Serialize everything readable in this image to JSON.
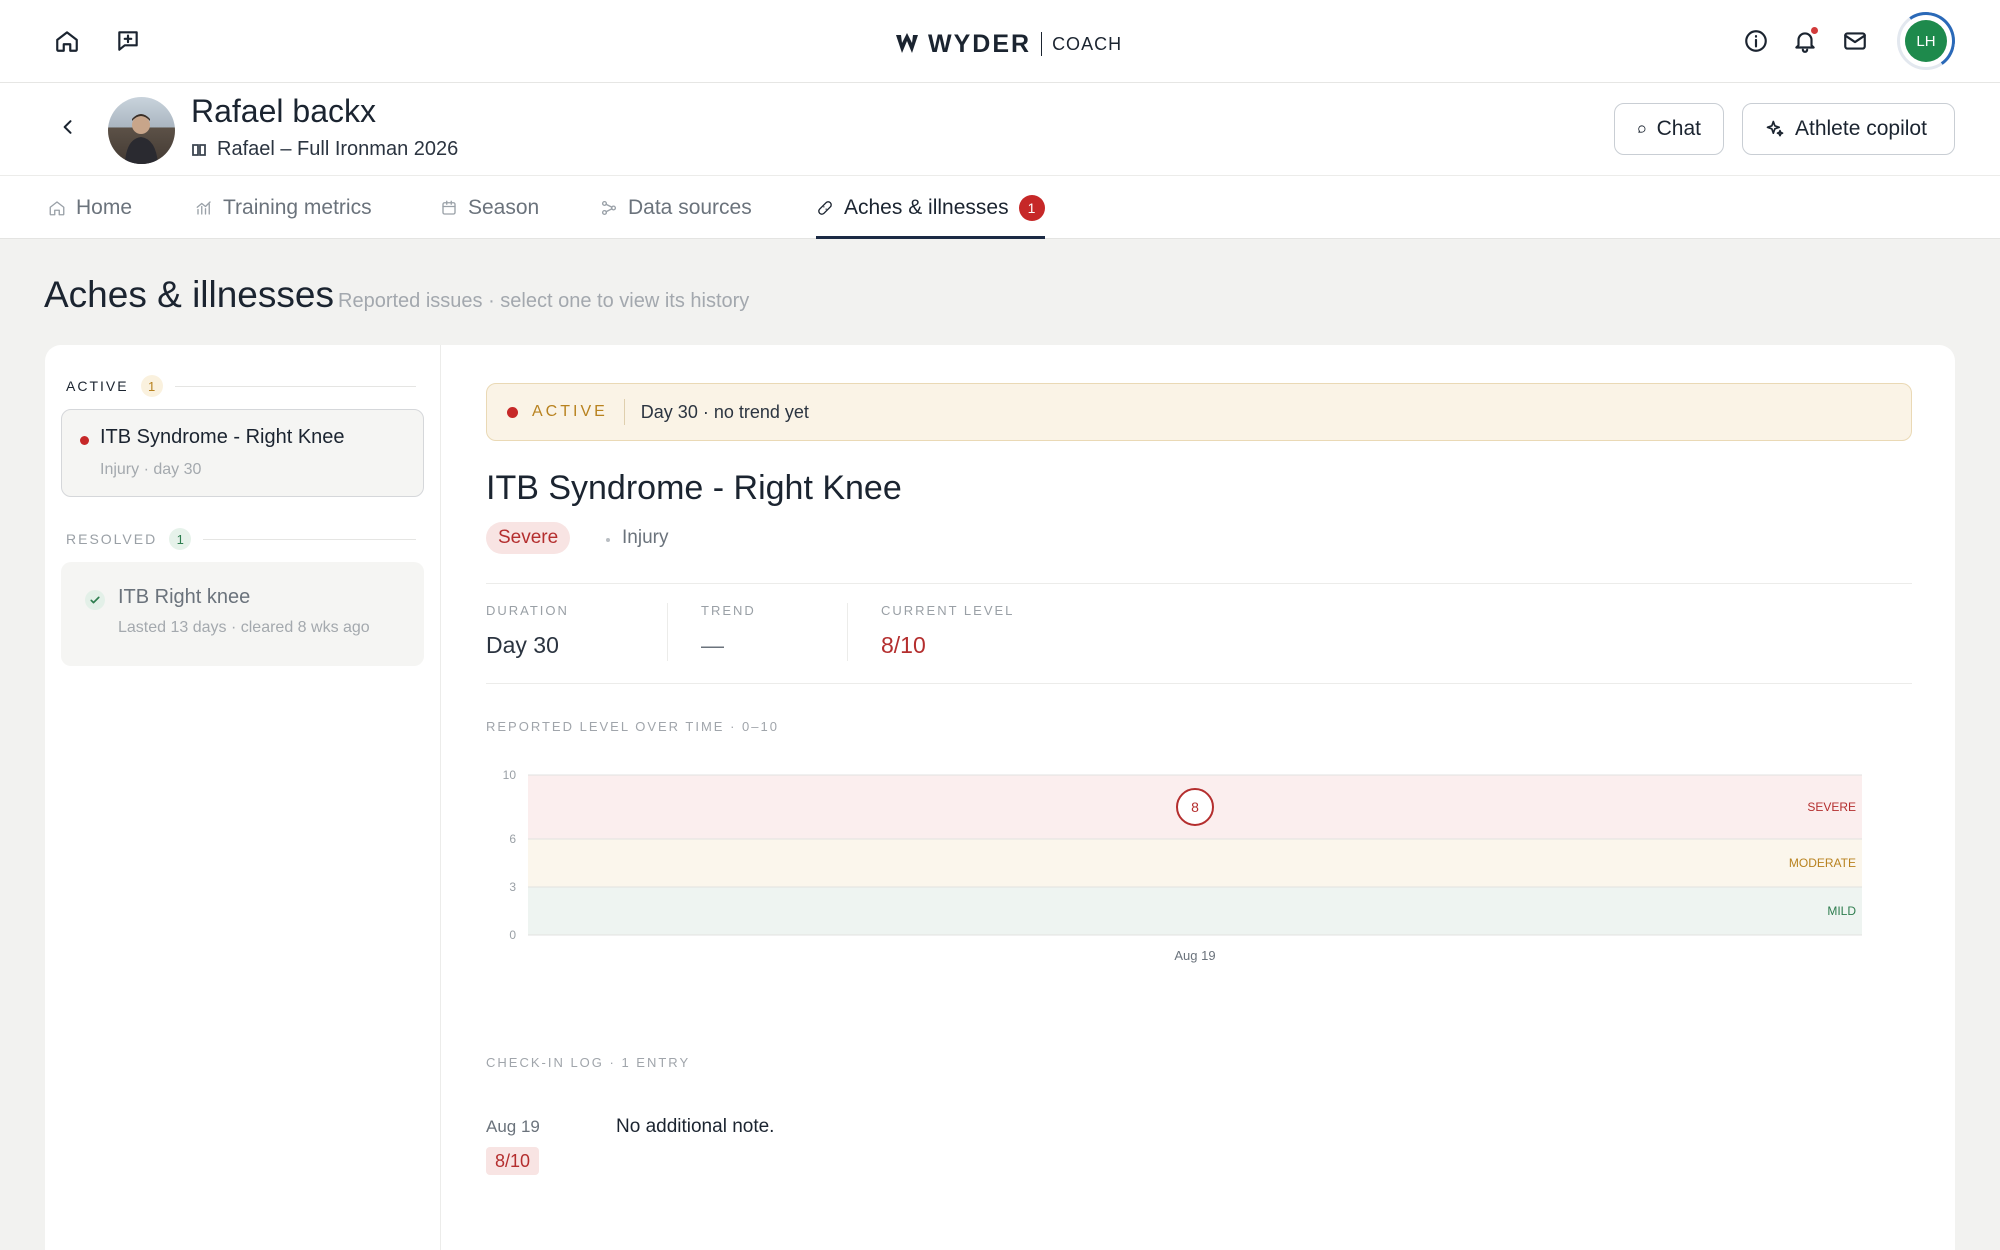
{
  "brand": {
    "name": "WYDER",
    "product": "COACH"
  },
  "user": {
    "initials": "LH"
  },
  "athlete": {
    "name": "Rafael backx",
    "program": "Rafael – Full Ironman 2026"
  },
  "actions": {
    "chat": "Chat",
    "copilot": "Athlete copilot"
  },
  "tabs": [
    {
      "label": "Home",
      "icon": "home-icon"
    },
    {
      "label": "Training metrics",
      "icon": "chart-icon"
    },
    {
      "label": "Season",
      "icon": "calendar-icon"
    },
    {
      "label": "Data sources",
      "icon": "nodes-icon"
    },
    {
      "label": "Aches & illnesses",
      "icon": "bandage-icon",
      "badge": "1",
      "active": true
    }
  ],
  "page": {
    "title": "Aches & illnesses",
    "subtitle": "Reported issues · select one to view its history"
  },
  "sidebar": {
    "active": {
      "label": "ACTIVE",
      "count": "1",
      "items": [
        {
          "title": "ITB Syndrome - Right Knee",
          "meta": "Injury · day 30"
        }
      ]
    },
    "resolved": {
      "label": "RESOLVED",
      "count": "1",
      "items": [
        {
          "title": "ITB Right knee",
          "meta": "Lasted 13 days · cleared 8 wks ago"
        }
      ]
    }
  },
  "detail": {
    "status": {
      "label": "ACTIVE",
      "text": "Day 30 · no trend yet"
    },
    "title": "ITB Syndrome - Right Knee",
    "severity": "Severe",
    "type": "Injury",
    "stats": [
      {
        "label": "DURATION",
        "value": "Day 30"
      },
      {
        "label": "TREND",
        "value": "—"
      },
      {
        "label": "CURRENT LEVEL",
        "value": "8/10"
      }
    ],
    "chart_label": "REPORTED LEVEL OVER TIME · 0–10",
    "log_label": "CHECK-IN LOG · 1 ENTRY",
    "log": [
      {
        "date": "Aug 19",
        "level": "8/10",
        "note": "No additional note."
      }
    ]
  },
  "colors": {
    "accent_navy": "#1b2a44",
    "severe": "#b42e2e",
    "moderate": "#b8821f",
    "mild": "#2e7d4f",
    "avatar_green": "#1e8a4c"
  },
  "chart_data": {
    "type": "scatter",
    "y_range": [
      0,
      10
    ],
    "y_ticks": [
      "0",
      "3",
      "6",
      "10"
    ],
    "bands": [
      {
        "label": "MILD",
        "from": 0,
        "to": 3,
        "fill": "#eef4f1",
        "text_color": "#2e7d4f"
      },
      {
        "label": "MODERATE",
        "from": 3,
        "to": 6,
        "fill": "#fbf6ec",
        "text_color": "#b8821f"
      },
      {
        "label": "SEVERE",
        "from": 6,
        "to": 10,
        "fill": "#fbeeee",
        "text_color": "#b42e2e"
      }
    ],
    "x_labels": [
      "Aug 19"
    ],
    "points": [
      {
        "x": "Aug 19",
        "y": 8
      }
    ]
  }
}
